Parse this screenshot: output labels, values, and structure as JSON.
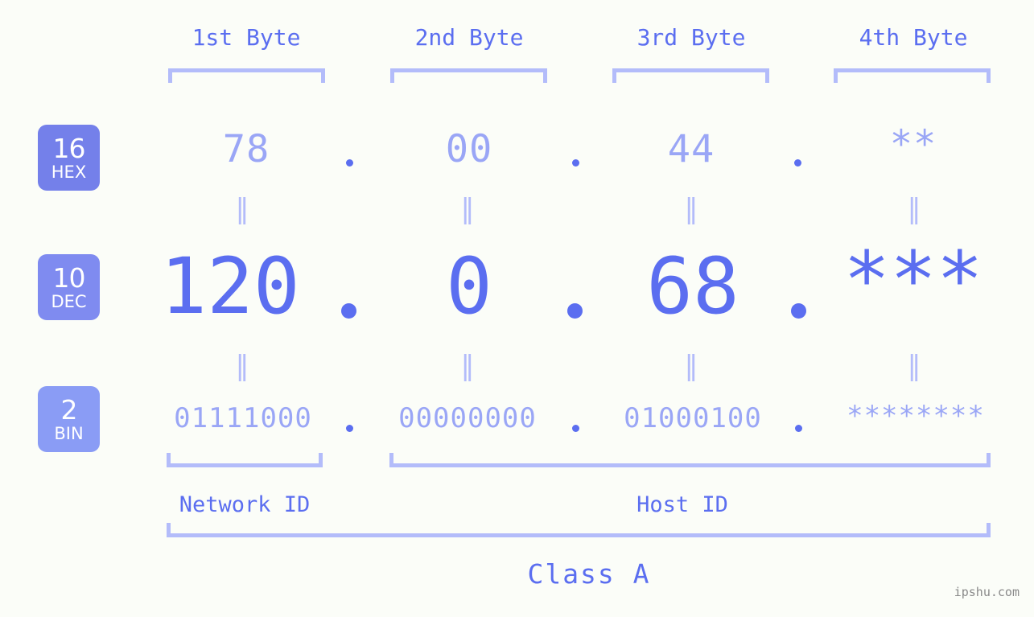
{
  "meta": {
    "watermark": "ipshu.com"
  },
  "header": {
    "byte_labels": [
      "1st Byte",
      "2nd Byte",
      "3rd Byte",
      "4th Byte"
    ]
  },
  "bases": [
    {
      "number": "16",
      "name": "HEX",
      "color": "#7480ea"
    },
    {
      "number": "10",
      "name": "DEC",
      "color": "#7f8bf0"
    },
    {
      "number": "2",
      "name": "BIN",
      "color": "#8a9cf5"
    }
  ],
  "rows": {
    "hex": {
      "values": [
        "78",
        "00",
        "44",
        "**"
      ]
    },
    "dec": {
      "values": [
        "120",
        "0",
        "68",
        "***"
      ]
    },
    "bin": {
      "values": [
        "01111000",
        "00000000",
        "01000100",
        "********"
      ]
    }
  },
  "separators": {
    "dot": ".",
    "equals": "‖"
  },
  "footer": {
    "network_id": "Network ID",
    "host_id": "Host ID",
    "class": "Class A"
  },
  "colors": {
    "background": "#fbfdf8",
    "accent_strong": "#5b6ef0",
    "accent_light": "#9aa6f6",
    "bracket": "#b3bcfa",
    "watermark": "#8a8a8a"
  }
}
